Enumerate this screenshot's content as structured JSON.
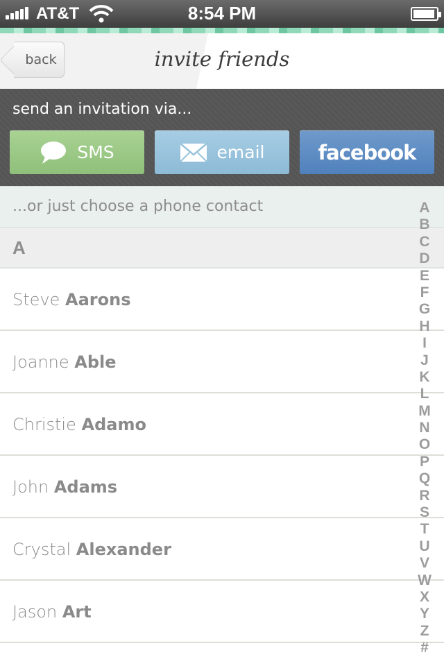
{
  "status_bar": {
    "carrier": "AT&T",
    "time": "8:54 PM",
    "signal_bars": 5,
    "battery_level": 0.95
  },
  "header": {
    "back_label": "back",
    "title": "invite friends"
  },
  "invite": {
    "label": "send an invitation via...",
    "buttons": [
      {
        "label": "SMS",
        "icon": "speech-bubble-icon",
        "color": "#9dc987"
      },
      {
        "label": "email",
        "icon": "envelope-icon",
        "color": "#98c3dd"
      },
      {
        "label": "facebook",
        "icon": "",
        "color": "#5f8dc3"
      }
    ]
  },
  "contacts": {
    "hint": "...or just choose a phone contact",
    "section": "A",
    "rows": [
      {
        "first": "Steve",
        "last": "Aarons"
      },
      {
        "first": "Joanne",
        "last": "Able"
      },
      {
        "first": "Christie",
        "last": "Adamo"
      },
      {
        "first": "John",
        "last": "Adams"
      },
      {
        "first": "Crystal",
        "last": "Alexander"
      },
      {
        "first": "Jason",
        "last": "Art"
      }
    ]
  },
  "index": [
    "A",
    "B",
    "C",
    "D",
    "E",
    "F",
    "G",
    "H",
    "I",
    "J",
    "K",
    "L",
    "M",
    "N",
    "O",
    "P",
    "Q",
    "R",
    "S",
    "T",
    "U",
    "V",
    "W",
    "X",
    "Y",
    "Z",
    "#"
  ]
}
